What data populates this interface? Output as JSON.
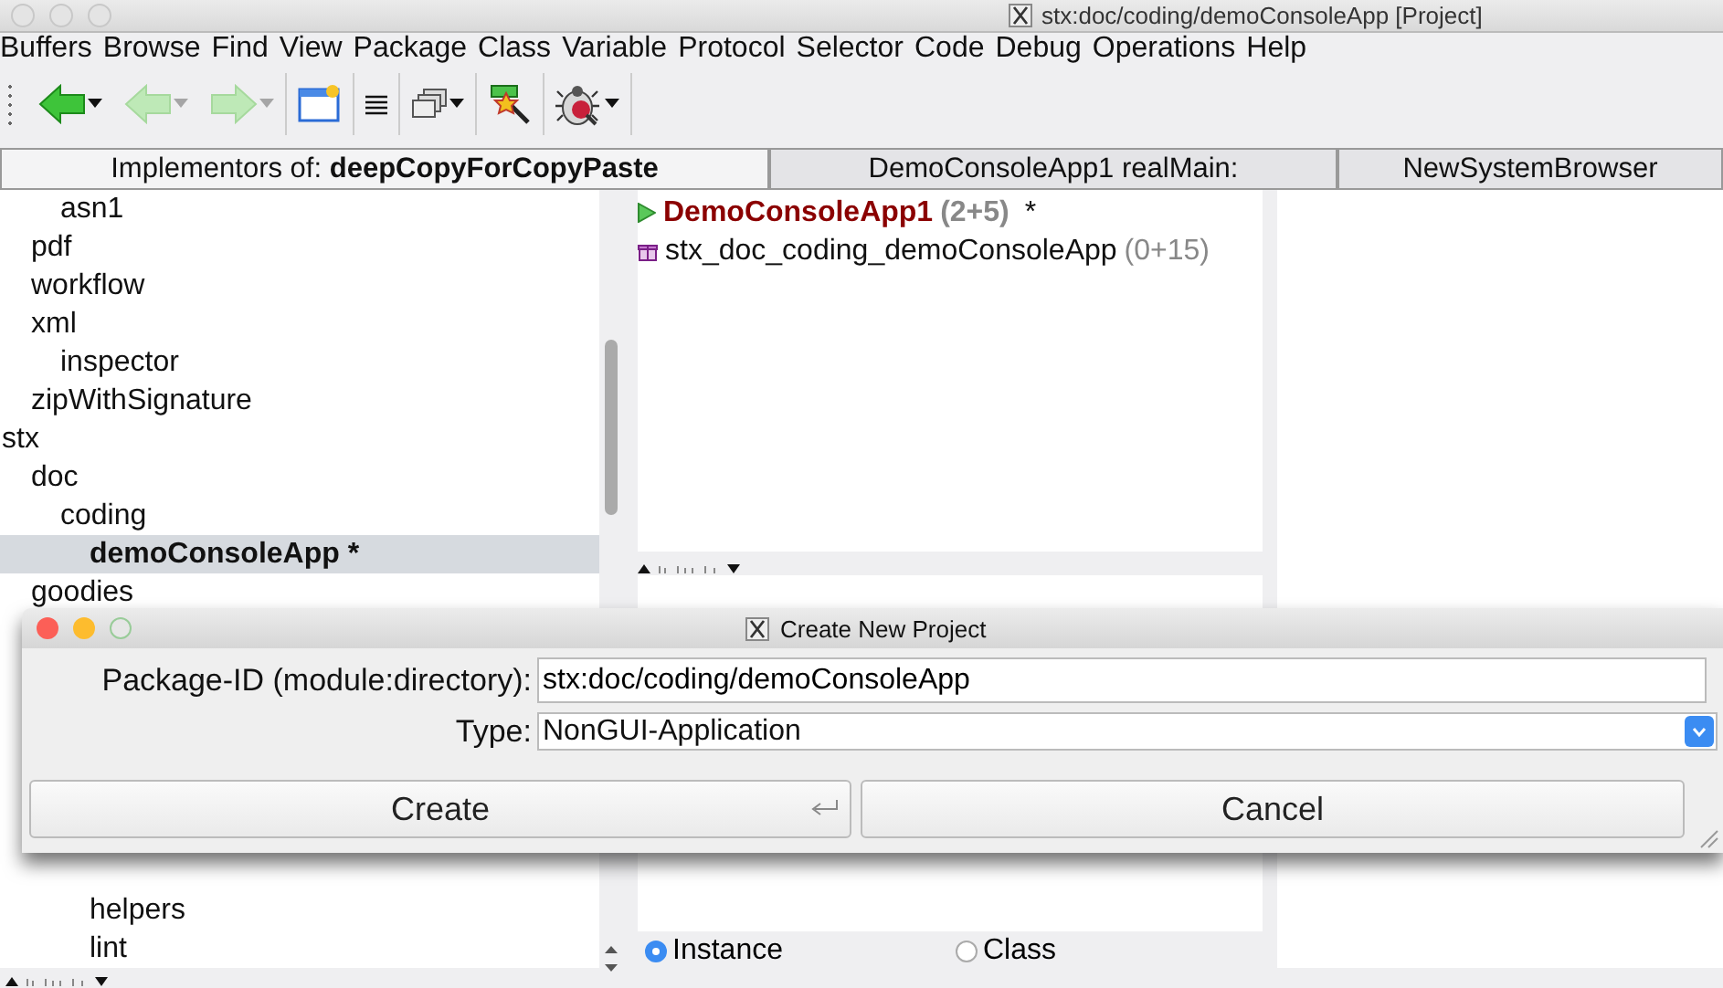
{
  "window": {
    "title": "stx:doc/coding/demoConsoleApp [Project]"
  },
  "menu": [
    "Buffers",
    "Browse",
    "Find",
    "View",
    "Package",
    "Class",
    "Variable",
    "Protocol",
    "Selector",
    "Code",
    "Debug",
    "Operations",
    "Help"
  ],
  "toolbar": [
    {
      "kind": "back",
      "disabled": false,
      "dropdown": true
    },
    {
      "kind": "back",
      "disabled": true,
      "dropdown": true
    },
    {
      "kind": "forward",
      "disabled": true,
      "dropdown": true
    },
    {
      "kind": "new-window",
      "disabled": false,
      "dropdown": false
    },
    {
      "kind": "list",
      "disabled": false,
      "dropdown": false
    },
    {
      "kind": "windows",
      "disabled": false,
      "dropdown": true
    },
    {
      "kind": "wand",
      "disabled": false,
      "dropdown": false
    },
    {
      "kind": "bug",
      "disabled": false,
      "dropdown": true
    }
  ],
  "tabs": [
    {
      "label": "Implementors of: **deepCopyForCopyPaste**",
      "selected": true
    },
    {
      "label": "DemoConsoleApp1 realMain:",
      "selected": false
    },
    {
      "label": "NewSystemBrowser",
      "selected": false
    }
  ],
  "package_tree": [
    {
      "children": [
        {
          "children": [
            {
              "label": "asn1",
              "selected": false
            }
          ]
        },
        {
          "label": "pdf",
          "selected": false
        },
        {
          "label": "workflow",
          "selected": false
        },
        {
          "label": "xml",
          "selected": false,
          "children": [
            {
              "label": "inspector",
              "selected": false
            }
          ]
        },
        {
          "label": "zipWithSignature",
          "selected": false
        }
      ]
    },
    {
      "label": "stx",
      "selected": false,
      "children": [
        {
          "label": "doc",
          "selected": false,
          "children": [
            {
              "label": "coding",
              "selected": false,
              "children": [
                {
                  "label": "demoConsoleApp *",
                  "selected": true
                }
              ]
            }
          ]
        },
        {
          "label": "goodies",
          "selected": false
        },
        {
          "children": [
            {
              "children": [
                {
                  "label": "helpers",
                  "selected": false
                },
                {
                  "label": "lint",
                  "selected": false
                }
              ]
            }
          ]
        }
      ]
    }
  ],
  "class_list": [
    {
      "kind": "application",
      "name": "DemoConsoleApp1",
      "count": "(2+5)",
      "mark": "*"
    },
    {
      "kind": "project",
      "name": "stx_doc_coding_demoConsoleApp",
      "count": "(0+15)"
    }
  ],
  "class_side": [
    {
      "label": "Instance",
      "selected": true
    },
    {
      "label": "Class",
      "selected": false
    }
  ],
  "dialog": {
    "title": "Create New Project",
    "package_label": "Package-ID (module:directory):",
    "package_value": "stx:doc/coding/demoConsoleApp",
    "type_label": "Type:",
    "type_value": "NonGUI-Application",
    "buttons": [
      {
        "label": "Create",
        "default": true
      },
      {
        "label": "Cancel",
        "default": false
      }
    ]
  }
}
